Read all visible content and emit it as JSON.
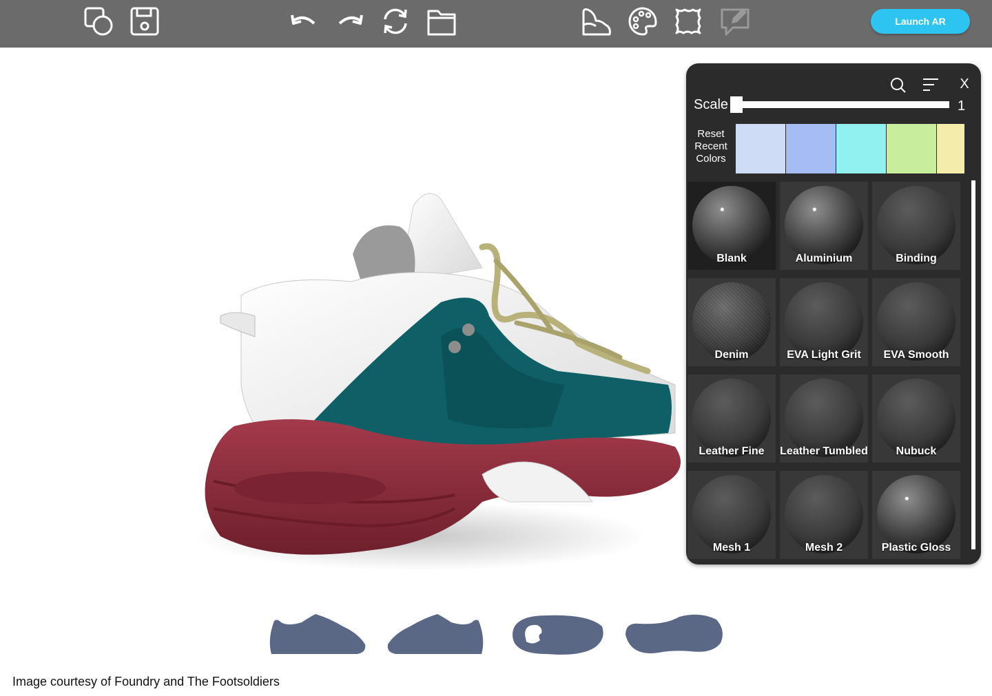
{
  "toolbar": {
    "buttons": [
      {
        "icon": "shapes-icon"
      },
      {
        "icon": "save-icon"
      },
      {
        "icon": "undo-icon"
      },
      {
        "icon": "redo-icon"
      },
      {
        "icon": "refresh-icon"
      },
      {
        "icon": "folder-icon"
      },
      {
        "icon": "shoe-view-icon"
      },
      {
        "icon": "palette-icon"
      },
      {
        "icon": "pattern-icon"
      },
      {
        "icon": "comment-icon"
      }
    ],
    "launch_ar": "Launch AR"
  },
  "panel": {
    "close_label": "X",
    "scale_label": "Scale",
    "scale_value": "1",
    "reset_label_line1": "Reset",
    "reset_label_line2": "Recent",
    "reset_label_line3": "Colors",
    "recent_colors": [
      "#cfdcf5",
      "#a5bdf3",
      "#90f1f0",
      "#c8ed9c",
      "#f3ecaa"
    ],
    "materials": [
      {
        "label": "Blank",
        "finish": "gloss"
      },
      {
        "label": "Aluminium",
        "finish": "gloss"
      },
      {
        "label": "Binding",
        "finish": "matte"
      },
      {
        "label": "Denim",
        "finish": "textured"
      },
      {
        "label": "EVA Light Grit",
        "finish": "matte"
      },
      {
        "label": "EVA Smooth",
        "finish": "matte"
      },
      {
        "label": "Leather Fine",
        "finish": "matte"
      },
      {
        "label": "Leather Tumbled",
        "finish": "matte"
      },
      {
        "label": "Nubuck",
        "finish": "matte"
      },
      {
        "label": "Mesh 1",
        "finish": "matte"
      },
      {
        "label": "Mesh 2",
        "finish": "matte"
      },
      {
        "label": "Plastic Gloss",
        "finish": "gloss"
      }
    ],
    "selected_material": "Blank"
  },
  "views": [
    "side-view",
    "medial-view",
    "top-view",
    "bottom-view"
  ],
  "colors": {
    "upper_teal": "#0f5f67",
    "sole_red": "#8c2a3a",
    "view_icon": "#5a6886",
    "accent": "#2ec4f1"
  },
  "credit": "Image courtesy of Foundry and The Footsoldiers"
}
